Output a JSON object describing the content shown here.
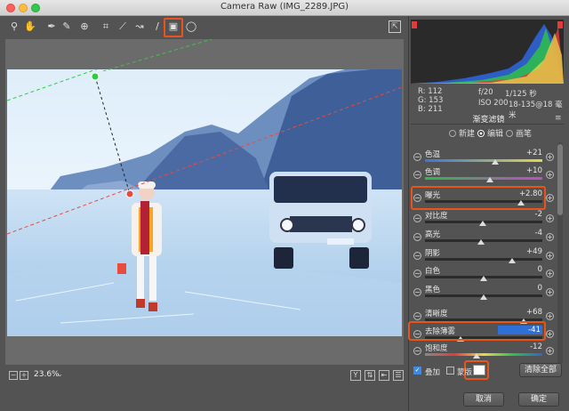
{
  "window": {
    "title": "Camera Raw (IMG_2289.JPG)"
  },
  "toolbar": {
    "tools": [
      "zoom-icon",
      "hand-icon",
      "white-balance-icon",
      "color-sampler-icon",
      "target-adjust-icon",
      "crop-icon",
      "straighten-icon",
      "spot-removal-icon",
      "adjustment-brush-icon",
      "graduated-filter-icon",
      "radial-filter-icon"
    ]
  },
  "info": {
    "r_label": "R:",
    "r_value": "112",
    "g_label": "G:",
    "g_value": "153",
    "b_label": "B:",
    "b_value": "211",
    "aperture": "f/20",
    "shutter": "1/125 秒",
    "iso": "ISO 200",
    "lens": "18-135@18 毫米"
  },
  "panel": {
    "title": "渐变滤镜",
    "modes": [
      {
        "label": "新建",
        "selected": false
      },
      {
        "label": "编辑",
        "selected": true
      },
      {
        "label": "画笔",
        "selected": false
      }
    ],
    "sliders": [
      {
        "label": "色温",
        "value": "+21",
        "pos": 0.6
      },
      {
        "label": "色调",
        "value": "+10",
        "pos": 0.55
      },
      {
        "label": "曝光",
        "value": "+2.80",
        "pos": 0.82
      },
      {
        "label": "对比度",
        "value": "-2",
        "pos": 0.49
      },
      {
        "label": "高光",
        "value": "-4",
        "pos": 0.48
      },
      {
        "label": "阴影",
        "value": "+49",
        "pos": 0.74
      },
      {
        "label": "白色",
        "value": "0",
        "pos": 0.5
      },
      {
        "label": "黑色",
        "value": "0",
        "pos": 0.5
      },
      {
        "label": "清晰度",
        "value": "+68",
        "pos": 0.84
      },
      {
        "label": "去除薄雾",
        "value": "-41",
        "pos": 0.3
      },
      {
        "label": "饱和度",
        "value": "-12",
        "pos": 0.44
      }
    ]
  },
  "overlay": {
    "label": "叠加",
    "checked": true
  },
  "mask": {
    "label": "蒙版",
    "checked": false
  },
  "clear_all": "清除全部",
  "zoom": {
    "value": "23.6%"
  },
  "buttons": {
    "cancel": "取消",
    "ok": "确定"
  },
  "colors": {
    "highlight": "#e8541c",
    "selected_value": "#2e6fd8"
  }
}
